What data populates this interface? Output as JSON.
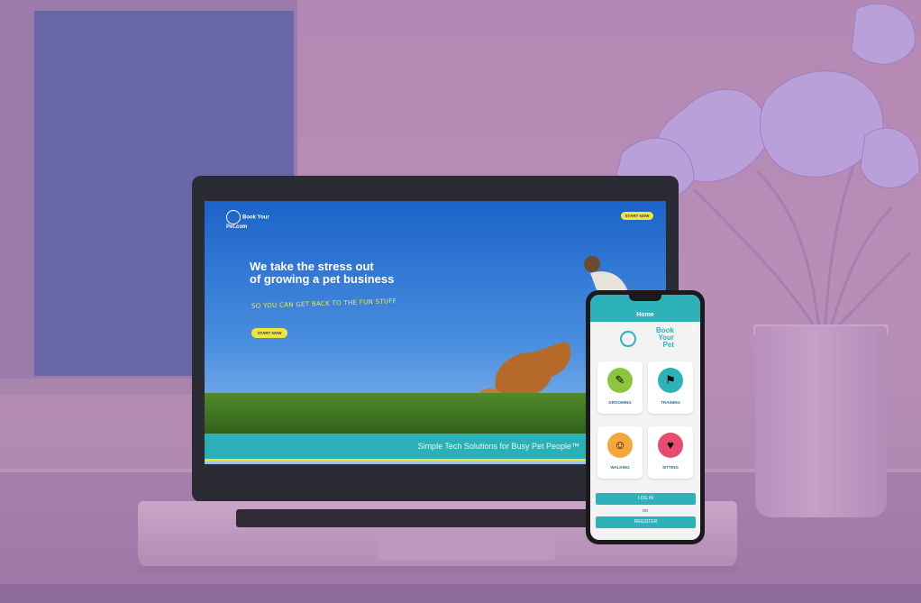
{
  "website": {
    "logo_text": "Book Your Pet.com",
    "top_button": "START NOW",
    "headline_line1": "We take the stress out",
    "headline_line2": "of growing a pet business",
    "tagline_script": "SO YOU CAN GET BACK TO THE FUN STUFF",
    "start_button": "START NOW",
    "band_text": "Simple Tech Solutions for Busy Pet People™"
  },
  "phone_app": {
    "title": "Home",
    "logo_line1": "Book",
    "logo_line2": "Your",
    "logo_line3": "Pet",
    "tiles": [
      {
        "label": "GROOMING",
        "icon": "grooming-icon",
        "color": "#8cc63f"
      },
      {
        "label": "TRAINING",
        "icon": "training-icon",
        "color": "#2eb2ba"
      },
      {
        "label": "WALKING",
        "icon": "walking-icon",
        "color": "#f7a63b"
      },
      {
        "label": "SITTING",
        "icon": "sitting-icon",
        "color": "#e74c6f"
      }
    ],
    "login_label": "LOG IN",
    "or_label": "OR",
    "register_label": "REGISTER"
  },
  "colors": {
    "brand_teal": "#2eb2ba",
    "accent_yellow": "#f1e43a",
    "background_mauve": "#b488b4"
  }
}
